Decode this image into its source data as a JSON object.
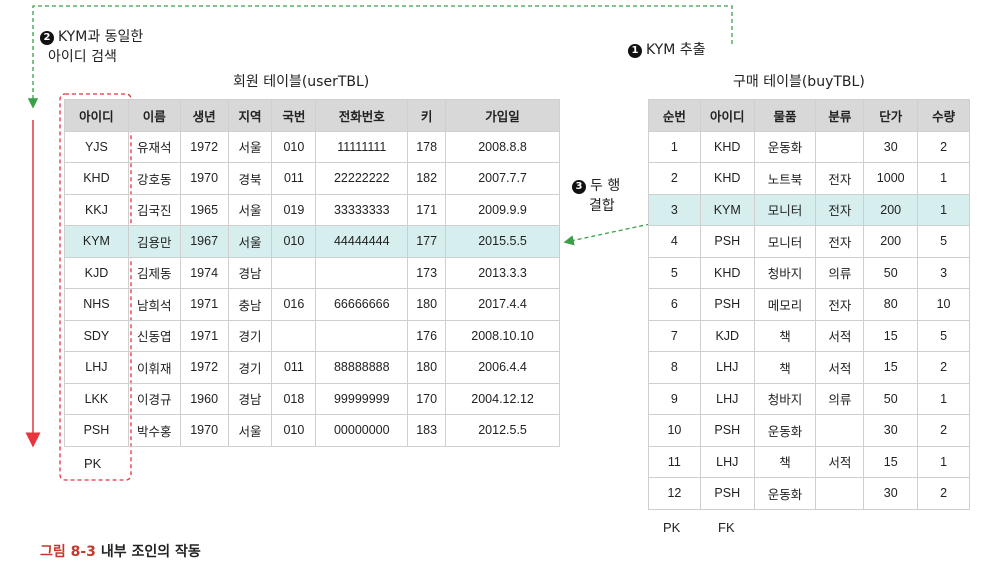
{
  "notes": {
    "step2_num": "2",
    "step2_line1": "KYM과 동일한",
    "step2_line2": "아이디 검색",
    "step1_num": "1",
    "step1_text": "KYM 추출",
    "step3_num": "3",
    "step3_line1": "두 행",
    "step3_line2": "결합"
  },
  "user_table": {
    "title": "회원 테이블(userTBL)",
    "headers": [
      "아이디",
      "이름",
      "생년",
      "지역",
      "국번",
      "전화번호",
      "키",
      "가입일"
    ],
    "rows": [
      [
        "YJS",
        "유재석",
        "1972",
        "서울",
        "010",
        "11111111",
        "178",
        "2008.8.8"
      ],
      [
        "KHD",
        "강호동",
        "1970",
        "경북",
        "011",
        "22222222",
        "182",
        "2007.7.7"
      ],
      [
        "KKJ",
        "김국진",
        "1965",
        "서울",
        "019",
        "33333333",
        "171",
        "2009.9.9"
      ],
      [
        "KYM",
        "김용만",
        "1967",
        "서울",
        "010",
        "44444444",
        "177",
        "2015.5.5"
      ],
      [
        "KJD",
        "김제동",
        "1974",
        "경남",
        "",
        "",
        "173",
        "2013.3.3"
      ],
      [
        "NHS",
        "남희석",
        "1971",
        "충남",
        "016",
        "66666666",
        "180",
        "2017.4.4"
      ],
      [
        "SDY",
        "신동엽",
        "1971",
        "경기",
        "",
        "",
        "176",
        "2008.10.10"
      ],
      [
        "LHJ",
        "이휘재",
        "1972",
        "경기",
        "011",
        "88888888",
        "180",
        "2006.4.4"
      ],
      [
        "LKK",
        "이경규",
        "1960",
        "경남",
        "018",
        "99999999",
        "170",
        "2004.12.12"
      ],
      [
        "PSH",
        "박수홍",
        "1970",
        "서울",
        "010",
        "00000000",
        "183",
        "2012.5.5"
      ]
    ],
    "highlight_row": 3,
    "key_label": "PK"
  },
  "buy_table": {
    "title": "구매 테이블(buyTBL)",
    "headers": [
      "순번",
      "아이디",
      "물품",
      "분류",
      "단가",
      "수량"
    ],
    "rows": [
      [
        "1",
        "KHD",
        "운동화",
        "",
        "30",
        "2"
      ],
      [
        "2",
        "KHD",
        "노트북",
        "전자",
        "1000",
        "1"
      ],
      [
        "3",
        "KYM",
        "모니터",
        "전자",
        "200",
        "1"
      ],
      [
        "4",
        "PSH",
        "모니터",
        "전자",
        "200",
        "5"
      ],
      [
        "5",
        "KHD",
        "청바지",
        "의류",
        "50",
        "3"
      ],
      [
        "6",
        "PSH",
        "메모리",
        "전자",
        "80",
        "10"
      ],
      [
        "7",
        "KJD",
        "책",
        "서적",
        "15",
        "5"
      ],
      [
        "8",
        "LHJ",
        "책",
        "서적",
        "15",
        "2"
      ],
      [
        "9",
        "LHJ",
        "청바지",
        "의류",
        "50",
        "1"
      ],
      [
        "10",
        "PSH",
        "운동화",
        "",
        "30",
        "2"
      ],
      [
        "11",
        "LHJ",
        "책",
        "서적",
        "15",
        "1"
      ],
      [
        "12",
        "PSH",
        "운동화",
        "",
        "30",
        "2"
      ]
    ],
    "highlight_row": 2,
    "key_label_1": "PK",
    "key_label_2": "FK"
  },
  "caption": {
    "number": "그림 8-3",
    "text": "내부 조인의 작동"
  },
  "colors": {
    "highlight": "#d6eeee",
    "arrow_red": "#e8343c",
    "arrow_green": "#3aa048",
    "header_bg": "#d8d8d8"
  }
}
